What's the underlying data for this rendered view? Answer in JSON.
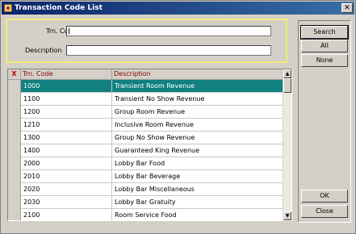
{
  "window": {
    "title": "Transaction Code List",
    "close_glyph": "✕"
  },
  "search": {
    "trn_code_label": "Trn. Code",
    "trn_code_value": "",
    "description_label": "Description",
    "description_value": ""
  },
  "grid": {
    "headers": {
      "delete": "X",
      "trn_code": "Trn. Code",
      "description": "Description"
    },
    "rows": [
      {
        "code": "1000",
        "description": "Transient Room Revenue",
        "selected": true
      },
      {
        "code": "1100",
        "description": "Transient No Show Revenue"
      },
      {
        "code": "1200",
        "description": "Group Room Revenue"
      },
      {
        "code": "1210",
        "description": "Inclusive Room Revenue"
      },
      {
        "code": "1300",
        "description": "Group No Show Revenue"
      },
      {
        "code": "1400",
        "description": "Guaranteed King Revenue"
      },
      {
        "code": "2000",
        "description": "Lobby Bar Food"
      },
      {
        "code": "2010",
        "description": "Lobby Bar Beverage"
      },
      {
        "code": "2020",
        "description": "Lobby Bar Miscellaneous"
      },
      {
        "code": "2030",
        "description": "Lobby Bar Gratuity"
      },
      {
        "code": "2100",
        "description": "Room Service Food"
      }
    ],
    "scroll_up_glyph": "▲",
    "scroll_down_glyph": "▼"
  },
  "buttons": {
    "search": "Search",
    "all": "All",
    "none": "None",
    "ok": "OK",
    "close": "Close"
  },
  "colors": {
    "selection": "#11807f",
    "titlebar": "#0a246a",
    "search_border": "#f3ec7a",
    "header_text": "#8b0000"
  }
}
